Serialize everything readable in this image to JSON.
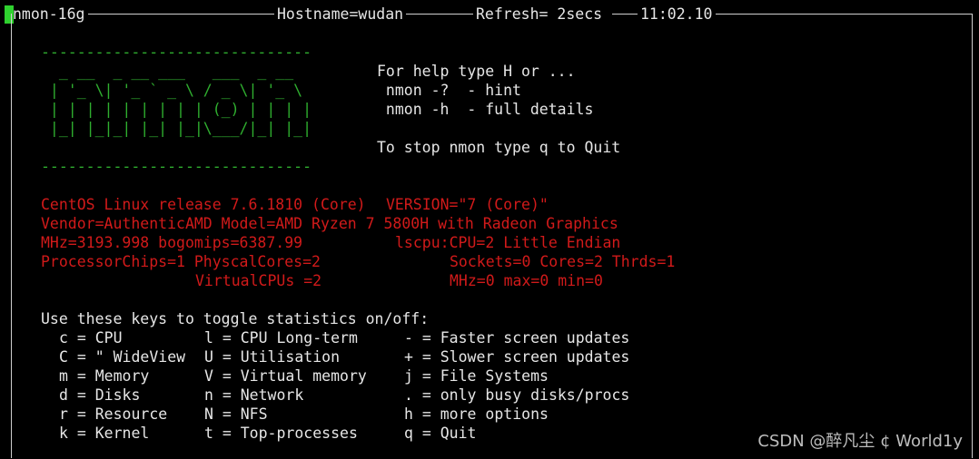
{
  "header": {
    "app": "nmon-16g",
    "hostname": "Hostname=wudan",
    "refresh": "Refresh= 2secs",
    "time": "11:02.10"
  },
  "logo": {
    "dash_line": "------------------------------",
    "art": [
      "  _ __  _ __ ___   ___  _ __  ",
      " | '_ \\| '_ ` _ \\ / _ \\| '_ \\ ",
      " | | | | | | | | | (_) | | | |",
      " |_| |_|_| |_| |_|\\___/|_| |_|"
    ]
  },
  "help": {
    "line1": "For help type H or ...",
    "line2": " nmon -?  - hint",
    "line3": " nmon -h  - full details",
    "line4": "To stop nmon type q to Quit"
  },
  "system_info": {
    "row1a": "CentOS Linux release 7.6.1810 (Core)",
    "row1b": "VERSION=\"7 (Core)\"",
    "row2": "Vendor=AuthenticAMD Model=AMD Ryzen 7 5800H with Radeon Graphics",
    "row3a": "MHz=3193.998 bogomips=6387.99",
    "row3b": "lscpu:CPU=2 Little Endian",
    "row4a": "ProcessorChips=1 PhyscalCores=2",
    "row4b": "Sockets=0 Cores=2 Thrds=1",
    "row5a": "VirtualCPUs =2",
    "row5b": "MHz=0 max=0 min=0"
  },
  "keys": {
    "title": "Use these keys to toggle statistics on/off:",
    "rows": [
      [
        "c = CPU",
        "l = CPU Long-term",
        "- = Faster screen updates"
      ],
      [
        "C = \" WideView",
        "U = Utilisation",
        "+ = Slower screen updates"
      ],
      [
        "m = Memory",
        "V = Virtual memory",
        "j = File Systems"
      ],
      [
        "d = Disks",
        "n = Network",
        ". = only busy disks/procs"
      ],
      [
        "r = Resource",
        "N = NFS",
        "h = more options"
      ],
      [
        "k = Kernel",
        "t = Top-processes",
        "q = Quit"
      ]
    ]
  },
  "watermark": "CSDN @醉凡尘 ¢  World1y"
}
